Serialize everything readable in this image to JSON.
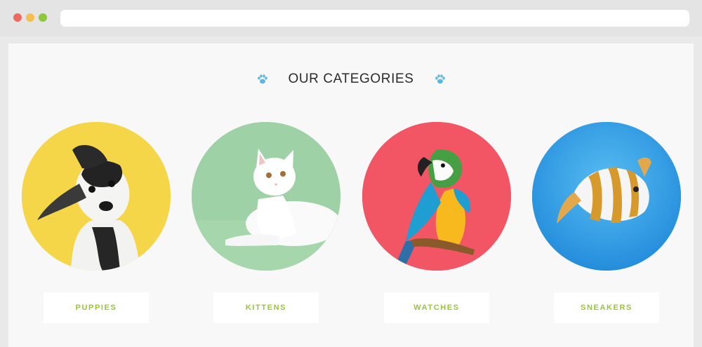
{
  "browser": {
    "traffic_lights": [
      {
        "name": "close",
        "color": "#ec6a5f"
      },
      {
        "name": "minimize",
        "color": "#f4bf4f"
      },
      {
        "name": "maximize",
        "color": "#8dc63f"
      }
    ],
    "address": ""
  },
  "section": {
    "title": "OUR CATEGORIES",
    "icon": "paw-icon",
    "icon_color": "#5ab6e3"
  },
  "categories": [
    {
      "label": "PUPPIES",
      "image": "dog-photo",
      "bg": "#f5d648"
    },
    {
      "label": "KITTENS",
      "image": "cat-photo",
      "bg": "#9fd1a6"
    },
    {
      "label": "WATCHES",
      "image": "parrot-photo",
      "bg": "#f25563"
    },
    {
      "label": "SNEAKERS",
      "image": "fish-photo",
      "bg": "#2f9ee8"
    }
  ],
  "accent_color": "#9bc43a"
}
